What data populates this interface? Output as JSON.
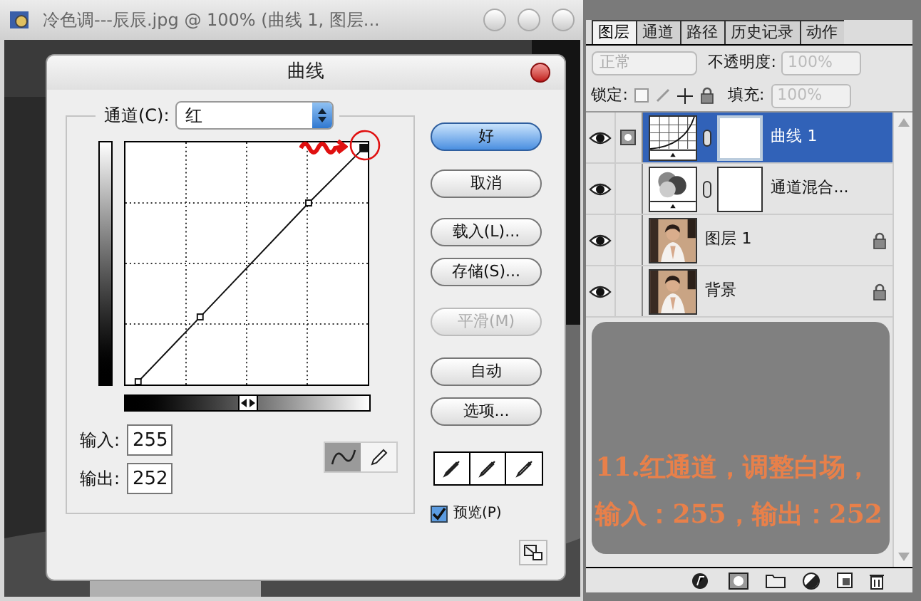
{
  "document_window": {
    "title": "冷色调---辰辰.jpg @ 100% (曲线 1, 图层..."
  },
  "curves_dialog": {
    "title": "曲线",
    "channel_label": "通道(C):",
    "channel_value": "红",
    "input_label": "输入:",
    "input_value": "255",
    "output_label": "输出:",
    "output_value": "252",
    "tools": [
      {
        "kind": "curve",
        "selected": true
      },
      {
        "kind": "pencil",
        "selected": false
      }
    ],
    "buttons": [
      {
        "label": "好",
        "default": true,
        "disabled": false
      },
      {
        "label": "取消",
        "default": false,
        "disabled": false
      },
      {
        "label": "载入(L)...",
        "default": false,
        "disabled": false
      },
      {
        "label": "存储(S)...",
        "default": false,
        "disabled": false
      },
      {
        "label": "平滑(M)",
        "default": false,
        "disabled": true
      },
      {
        "label": "自动",
        "default": false,
        "disabled": false
      },
      {
        "label": "选项...",
        "default": false,
        "disabled": false
      }
    ],
    "preview": {
      "label": "预览(P)",
      "checked": true
    }
  },
  "layers_panel": {
    "tabs": [
      {
        "label": "图层",
        "selected": true
      },
      {
        "label": "通道",
        "selected": false
      },
      {
        "label": "路径",
        "selected": false
      },
      {
        "label": "历史记录",
        "selected": false
      },
      {
        "label": "动作",
        "selected": false
      }
    ],
    "blend_mode": "正常",
    "opacity_label": "不透明度:",
    "opacity_value": "100%",
    "lock_label": "锁定:",
    "fill_label": "填充:",
    "fill_value": "100%",
    "layers": [
      {
        "name": "曲线 1",
        "kind": "curves",
        "selected": true,
        "locked": false
      },
      {
        "name": "通道混合...",
        "kind": "mixer",
        "selected": false,
        "locked": false
      },
      {
        "name": "图层 1",
        "selected": false,
        "locked": true
      },
      {
        "name": "背景",
        "selected": false,
        "locked": true
      }
    ]
  },
  "annotation": {
    "lines": [
      "11.红通道，调整白场，",
      "输入：255，输出：252"
    ]
  }
}
